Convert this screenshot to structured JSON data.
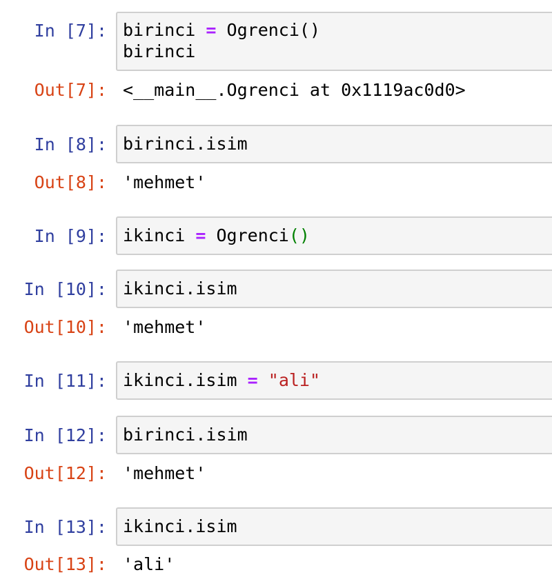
{
  "cells": [
    {
      "in_prompt": "In [7]:",
      "code": {
        "line1_var": "birinci",
        "line1_op": "=",
        "line1_call": "Ogrenci()",
        "line2": "birinci"
      },
      "out_prompt": "Out[7]:",
      "output": "<__main__.Ogrenci at 0x1119ac0d0>"
    },
    {
      "in_prompt": "In [8]:",
      "code": {
        "line1": "birinci.isim"
      },
      "out_prompt": "Out[8]:",
      "output": "'mehmet'"
    },
    {
      "in_prompt": "In [9]:",
      "code": {
        "var": "ikinci",
        "op": "=",
        "func": "Ogrenci",
        "parens": "()"
      }
    },
    {
      "in_prompt": "In [10]:",
      "code": {
        "line1": "ikinci.isim"
      },
      "out_prompt": "Out[10]:",
      "output": "'mehmet'"
    },
    {
      "in_prompt": "In [11]:",
      "code": {
        "lhs": "ikinci.isim",
        "op": "=",
        "str": "\"ali\""
      }
    },
    {
      "in_prompt": "In [12]:",
      "code": {
        "line1": "birinci.isim"
      },
      "out_prompt": "Out[12]:",
      "output": "'mehmet'"
    },
    {
      "in_prompt": "In [13]:",
      "code": {
        "line1": "ikinci.isim"
      },
      "out_prompt": "Out[13]:",
      "output": "'ali'"
    }
  ],
  "colors": {
    "in_prompt": "#303f9f",
    "out_prompt": "#d84315",
    "operator": "#aa22ff",
    "paren_highlight": "#008000",
    "string": "#ba2121",
    "cell_background": "#f5f5f5",
    "cell_border": "#cfcfcf"
  }
}
